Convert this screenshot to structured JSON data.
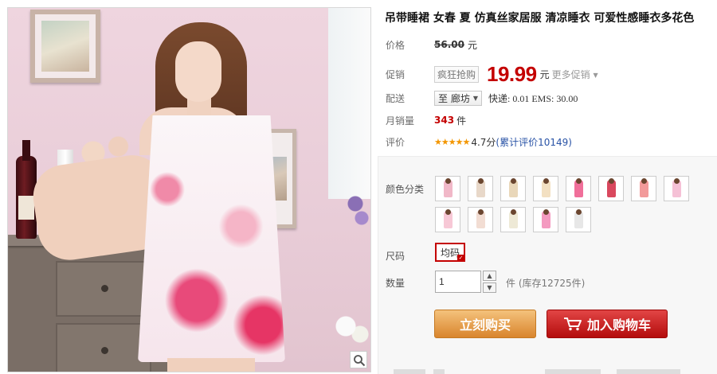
{
  "product": {
    "title": "吊带睡裙 女春 夏 仿真丝家居服 清凉睡衣 可爱性感睡衣多花色"
  },
  "price": {
    "label": "价格",
    "original": "56.00",
    "currency": "元"
  },
  "promotion": {
    "label": "促销",
    "tag": "疯狂抢购",
    "price": "19.99",
    "currency": "元",
    "more": "更多促销"
  },
  "shipping": {
    "label": "配送",
    "destination": "至 廊坊",
    "info": "快递: 0.01 EMS: 30.00"
  },
  "monthly_sales": {
    "label": "月销量",
    "count": "343",
    "unit": "件"
  },
  "review": {
    "label": "评价",
    "stars": "★★★★★",
    "score": "4.7分",
    "count_text": "(累计评价10149)"
  },
  "options": {
    "color_label": "颜色分类",
    "swatches": [
      {
        "color": "#f1b8c8"
      },
      {
        "color": "#e8d8c9"
      },
      {
        "color": "#e9d7b9"
      },
      {
        "color": "#f3e0c2"
      },
      {
        "color": "#f06f9a"
      },
      {
        "color": "#d9485e"
      },
      {
        "color": "#f29a9a"
      },
      {
        "color": "#f5c1d6"
      },
      {
        "color": "#f7c8d6"
      },
      {
        "color": "#f2ddd3"
      },
      {
        "color": "#eee9d6"
      },
      {
        "color": "#f49ac0"
      },
      {
        "color": "#e7e7e7"
      }
    ],
    "size_label": "尺码",
    "size_value": "均码",
    "qty_label": "数量",
    "qty_value": "1",
    "stock_text": "件 (库存12725件)"
  },
  "actions": {
    "buy_now": "立刻购买",
    "add_to_cart": "加入购物车"
  },
  "colors": {
    "accent_red": "#c40000",
    "buy_orange": "#d9852d",
    "link_blue": "#2953a6"
  }
}
